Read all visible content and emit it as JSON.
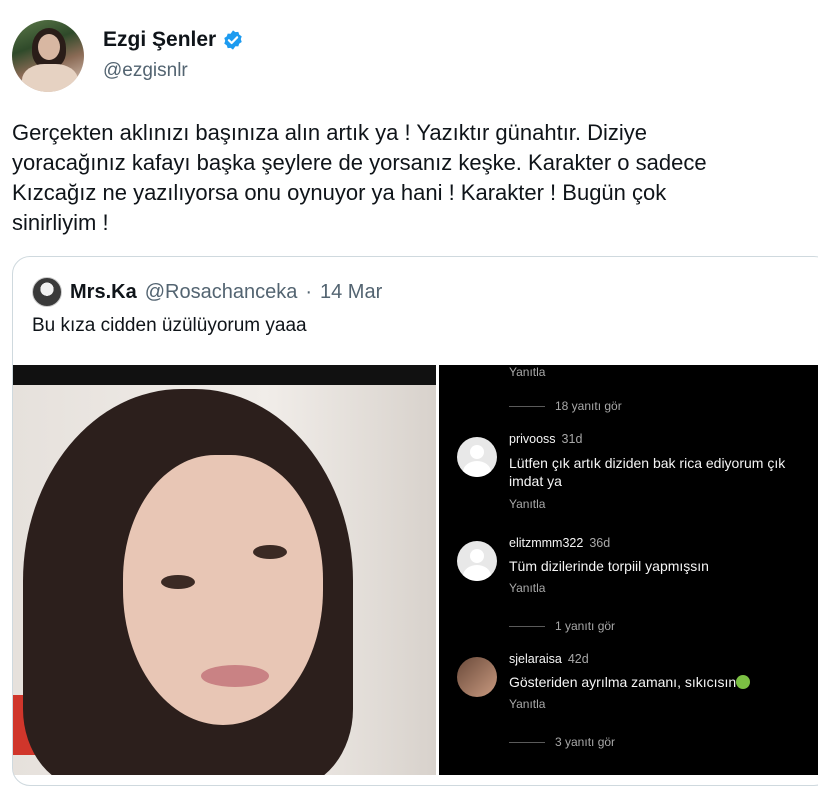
{
  "author": {
    "name": "Ezgi Şenler",
    "handle": "@ezgisnlr",
    "avatar_icon": "profile-photo",
    "verified_icon": "verified-badge-icon",
    "verified_color": "#1d9bf0"
  },
  "tweet": {
    "text": "Gerçekten aklınızı başınıza alın artık ya ! Yazıktır günahtır. Diziye\nyoracağınız kafayı başka şeylere de yorsanız keşke. Karakter o sadece\nKızcağız ne yazılıyorsa onu oynuyor ya hani ! Karakter ! Bugün çok\nsinirliyim !"
  },
  "quote": {
    "name": "Mrs.Ka",
    "handle": "@Rosachanceka",
    "separator": "·",
    "date": "14 Mar",
    "text": "Bu kıza cidden üzülüyorum yaaa"
  },
  "comments_screenshot": {
    "top_reply_label": "Yanıtla",
    "top_more": "18 yanıtı gör",
    "comments": [
      {
        "user": "privooss",
        "age": "31d",
        "text": "Lütfen çık artık diziden bak rica ediyorum çık imdat ya",
        "reply": "Yanıtla"
      },
      {
        "user": "elitzmmm322",
        "age": "36d",
        "text": "Tüm dizilerinde torpiil yapmışsın",
        "reply": "Yanıtla",
        "more": "1 yanıtı gör"
      },
      {
        "user": "sjelaraisa",
        "age": "42d",
        "text": "Gösteriden ayrılma zamanı, sıkıcısın",
        "reply": "Yanıtla",
        "more": "3 yanıtı gör"
      }
    ]
  }
}
